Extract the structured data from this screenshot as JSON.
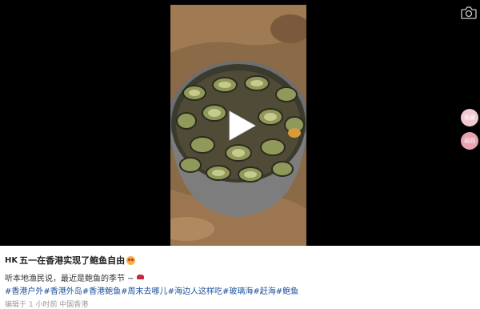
{
  "post": {
    "badge": "HK",
    "title": "五一在香港实现了鲍鱼自由",
    "description": "听本地渔民说，最近是鲍鱼的季节 ~",
    "tags": [
      "#香港户外",
      "#香港外岛",
      "#香港鲍鱼",
      "#周末去哪儿",
      "#海边人这样吃",
      "#玻璃海",
      "#赶海",
      "#鲍鱼"
    ],
    "meta": "编辑于 1 小时前 中国香港"
  },
  "side_buttons": {
    "collect_label": "收藏",
    "back_label": "返回"
  },
  "icons": {
    "camera": "camera-icon",
    "play": "play-icon",
    "face_emoji": "smiling-face-heart-eyes-emoji",
    "car_emoji": "car-emoji"
  },
  "colors": {
    "video_background": "#000000",
    "tag_color": "#1a4f9c",
    "side_button": "#f2c9cf"
  }
}
